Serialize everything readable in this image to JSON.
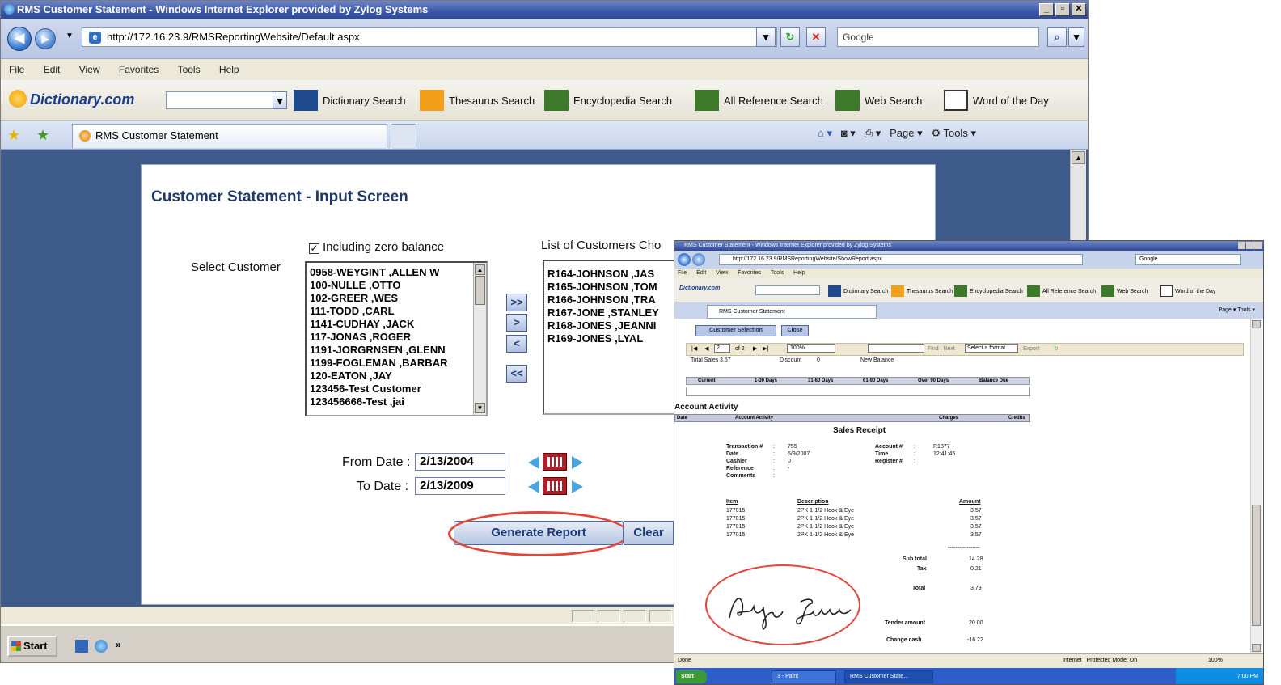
{
  "window": {
    "title": "RMS Customer Statement - Windows Internet Explorer provided by Zylog Systems",
    "url": "http://172.16.23.9/RMSReportingWebsite/Default.aspx",
    "search_placeholder": "Google",
    "menu": [
      "File",
      "Edit",
      "View",
      "Favorites",
      "Tools",
      "Help"
    ],
    "dict_logo": "Dictionary.com",
    "dict_tools": [
      "Dictionary Search",
      "Thesaurus Search",
      "Encyclopedia Search",
      "All Reference Search",
      "Web Search",
      "Word of the Day"
    ],
    "tab_title": "RMS Customer Statement",
    "cmd_page": "Page",
    "cmd_tools": "Tools"
  },
  "form": {
    "title": "Customer Statement - Input Screen",
    "zero_balance_label": "Including zero balance",
    "zero_balance_checked": true,
    "select_customer_label": "Select Customer",
    "chosen_label": "List of Customers Cho",
    "customers": [
      "0958-WEYGINT ,ALLEN W",
      "100-NULLE ,OTTO",
      "102-GREER ,WES",
      "111-TODD ,CARL",
      "1141-CUDHAY ,JACK",
      "117-JONAS ,ROGER",
      "1191-JORGRNSEN ,GLENN",
      "1199-FOGLEMAN ,BARBAR",
      "120-EATON ,JAY",
      "123456-Test Customer",
      "123456666-Test ,jai"
    ],
    "chosen": [
      "R164-JOHNSON ,JAS",
      "R165-JOHNSON ,TOM",
      "R166-JOHNSON ,TRA",
      "R167-JONE ,STANLEY",
      "R168-JONES ,JEANNI",
      "R169-JONES ,LYAL"
    ],
    "move_buttons": [
      ">>",
      ">",
      "<",
      "<<"
    ],
    "from_label": "From Date :",
    "from_value": "2/13/2004",
    "to_label": "To Date :",
    "to_value": "2/13/2009",
    "generate_label": "Generate Report",
    "clear_label": "Clear"
  },
  "taskbar": {
    "start_label": "Start"
  },
  "report_window": {
    "title": "RMS Customer Statement - Windows Internet Explorer provided by Zylog Systems",
    "url": "http://172.16.23.9/RMSReportingWebsite/ShowReport.aspx",
    "search_placeholder": "Google",
    "menu": [
      "File",
      "Edit",
      "View",
      "Favorites",
      "Tools",
      "Help"
    ],
    "dict_logo": "Dictionary.com",
    "dict_tools": [
      "Dictionary Search",
      "Thesaurus Search",
      "Encyclopedia Search",
      "All Reference Search",
      "Web Search",
      "Word of the Day"
    ],
    "tab_title": "RMS Customer Statement",
    "cmd_text": "Page ▾  Tools ▾",
    "btn_customer_selection": "Customer Selection",
    "btn_close": "Close",
    "page_current": "2",
    "page_total": "of 2",
    "zoom": "100%",
    "find_next": "Find | Next",
    "format_select": "Select a format",
    "export": "Export",
    "prev_row": [
      "Total Sales",
      "3.57",
      "Discount",
      "0",
      "New Balance"
    ],
    "aging_headers": [
      "Current",
      "1-30 Days",
      "31-60 Days",
      "61-90 Days",
      "Over 90 Days",
      "Balance Due"
    ],
    "account_activity": "Account Activity",
    "activity_headers": [
      "Date",
      "Account Activity",
      "Charges",
      "Credits"
    ],
    "receipt_title": "Sales Receipt",
    "fields_left": [
      {
        "label": "Transaction #",
        "value": "755"
      },
      {
        "label": "Date",
        "value": "5/9/2007"
      },
      {
        "label": "Cashier",
        "value": "0"
      },
      {
        "label": "Reference",
        "value": "-"
      },
      {
        "label": "Comments",
        "value": ""
      }
    ],
    "fields_right": [
      {
        "label": "Account #",
        "value": "R1377"
      },
      {
        "label": "Time",
        "value": "12:41:45"
      },
      {
        "label": "Register #",
        "value": ""
      }
    ],
    "item_headers": [
      "Item",
      "Description",
      "Amount"
    ],
    "items": [
      {
        "item": "177015",
        "desc": "2PK 1-1/2 Hook & Eye",
        "amount": "3.57"
      },
      {
        "item": "177015",
        "desc": "2PK 1-1/2 Hook & Eye",
        "amount": "3.57"
      },
      {
        "item": "177015",
        "desc": "2PK 1-1/2 Hook & Eye",
        "amount": "3.57"
      },
      {
        "item": "177015",
        "desc": "2PK 1-1/2 Hook & Eye",
        "amount": "3.57"
      }
    ],
    "dashes": "-----------------",
    "subtotal_label": "Sub total",
    "subtotal": "14.28",
    "tax_label": "Tax",
    "tax": "0.21",
    "total_label": "Total",
    "total": "3.79",
    "tender_label": "Tender amount",
    "tender": "20.00",
    "change_label": "Change cash",
    "change": "-16.22",
    "status_done": "Done",
    "status_zone": "Internet | Protected Mode: On",
    "status_zoom": "100%",
    "task_start": "Start",
    "task_item1": "3 - Paint",
    "task_item2": "RMS Customer State...",
    "clock": "7:00 PM"
  },
  "colors": {
    "highlight_ring": "#e0463a",
    "content_bg": "#3d5a8a",
    "titlebar": "#3a56a8"
  }
}
